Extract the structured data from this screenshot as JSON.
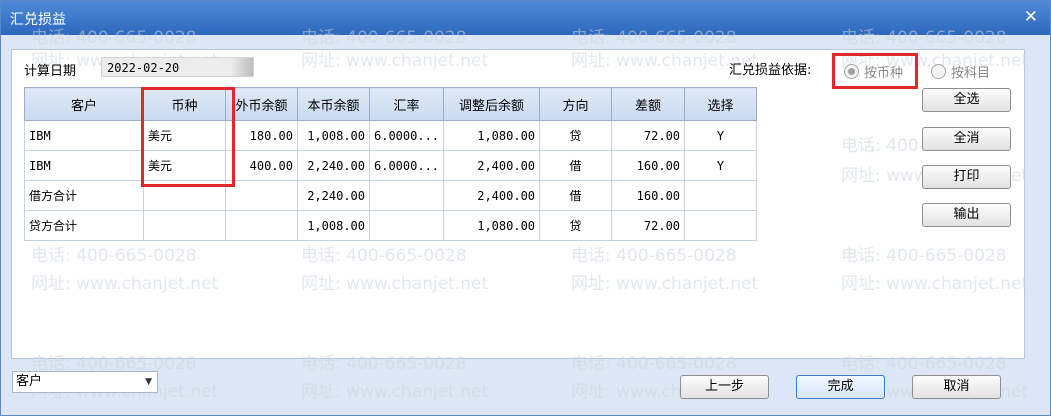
{
  "window": {
    "title": "汇兑损益"
  },
  "form": {
    "date_label": "计算日期",
    "date_value": "2022-02-20",
    "basis_label": "汇兑损益依据:",
    "basis_options": [
      "按币种",
      "按科目"
    ],
    "basis_selected": "按币种"
  },
  "table": {
    "headers": [
      "客户",
      "币种",
      "外币余额",
      "本币余额",
      "汇率",
      "调整后余额",
      "方向",
      "差额",
      "选择"
    ],
    "rows": [
      [
        "IBM",
        "美元",
        "180.00",
        "1,008.00",
        "6.0000...",
        "1,080.00",
        "贷",
        "72.00",
        "Y"
      ],
      [
        "IBM",
        "美元",
        "400.00",
        "2,240.00",
        "6.0000...",
        "2,400.00",
        "借",
        "160.00",
        "Y"
      ],
      [
        "借方合计",
        "",
        "",
        "2,240.00",
        "",
        "2,400.00",
        "借",
        "160.00",
        ""
      ],
      [
        "贷方合计",
        "",
        "",
        "1,008.00",
        "",
        "1,080.00",
        "贷",
        "72.00",
        ""
      ]
    ]
  },
  "side_buttons": {
    "select_all": "全选",
    "deselect_all": "全消",
    "print": "打印",
    "export": "输出"
  },
  "bottom": {
    "dropdown_value": "客户",
    "prev": "上一步",
    "finish": "完成",
    "cancel": "取消"
  },
  "watermark": {
    "phone": "电话: 400-665-0028",
    "site": "网址: www.chanjet.net"
  },
  "colors": {
    "titlebar": "#3a74c7",
    "highlight": "#e02a2a"
  }
}
